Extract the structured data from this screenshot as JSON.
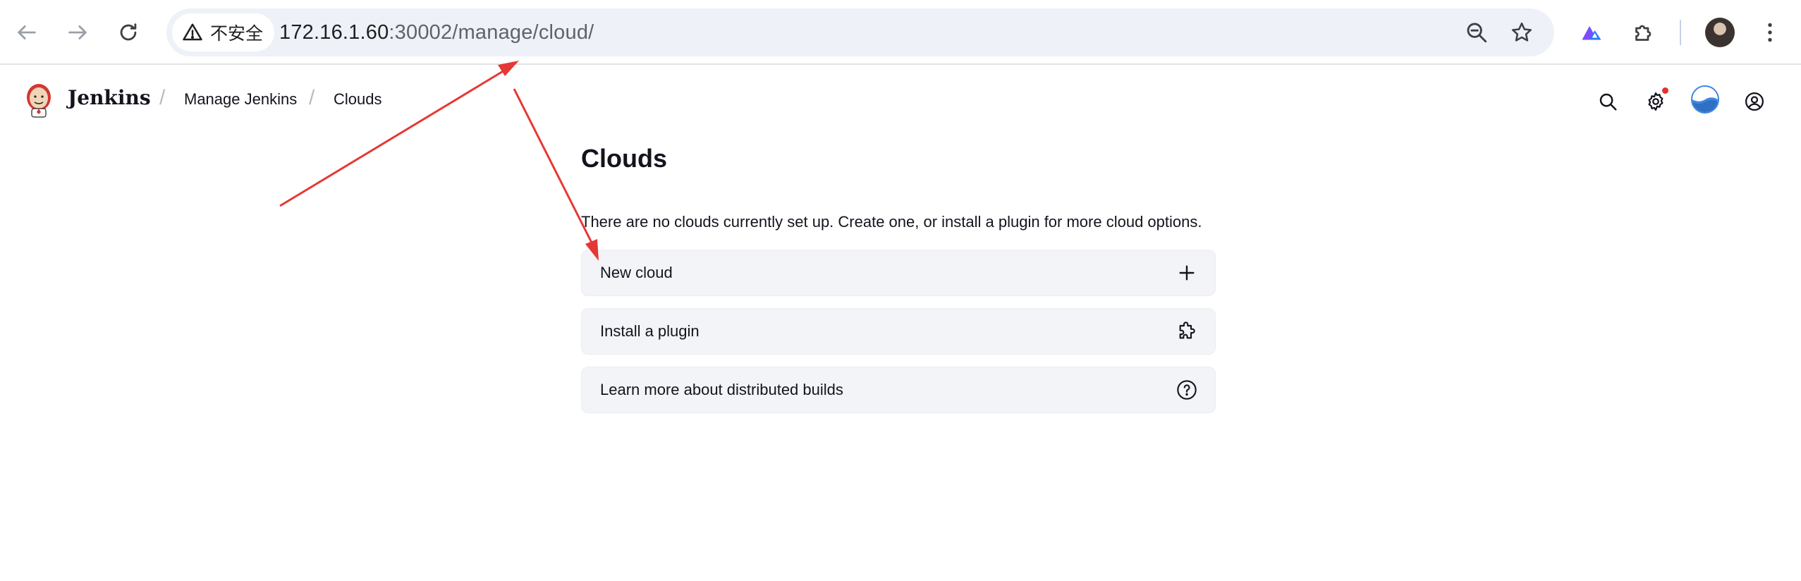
{
  "browser": {
    "security_label": "不安全",
    "url_host": "172.16.1.60",
    "url_path": ":30002/manage/cloud/"
  },
  "header": {
    "brand": "Jenkins",
    "breadcrumbs": [
      {
        "label": "Manage Jenkins"
      },
      {
        "label": "Clouds"
      }
    ]
  },
  "main": {
    "title": "Clouds",
    "empty_message": "There are no clouds currently set up. Create one, or install a plugin for more cloud options.",
    "actions": [
      {
        "label": "New cloud",
        "icon": "plus-icon"
      },
      {
        "label": "Install a plugin",
        "icon": "puzzle-icon"
      },
      {
        "label": "Learn more about distributed builds",
        "icon": "help-circle-icon"
      }
    ]
  },
  "colors": {
    "annotation_arrow": "#e53935",
    "card_background": "#f3f4f7",
    "omnibox_background": "#eef1f8",
    "notification_dot": "#e5312b"
  }
}
